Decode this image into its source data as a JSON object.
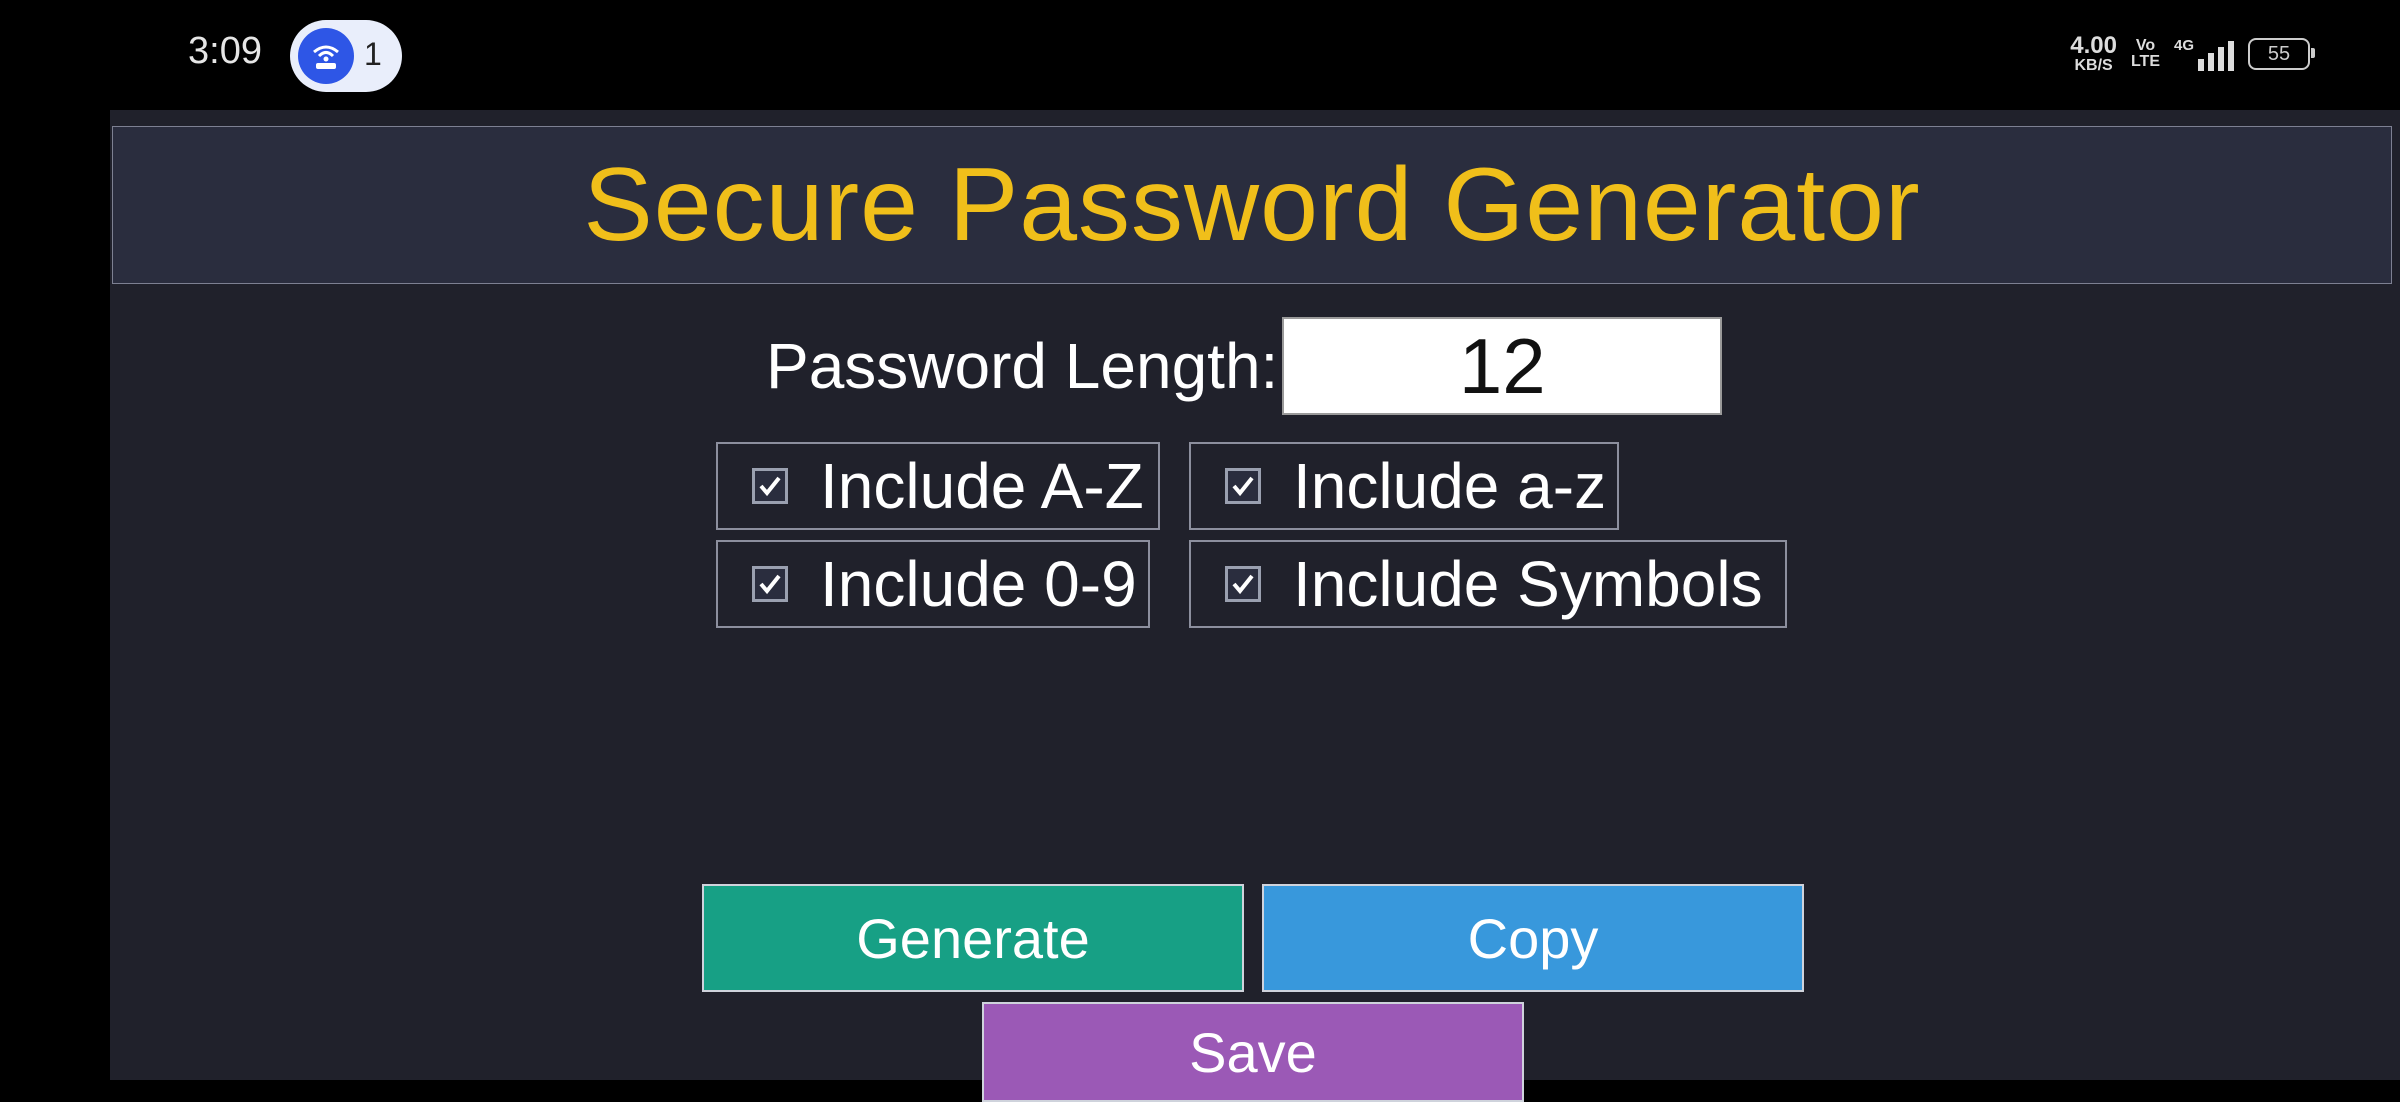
{
  "status_bar": {
    "time": "3:09",
    "hotspot_count": "1",
    "net_speed_value": "4.00",
    "net_speed_unit": "KB/S",
    "volte_top": "Vo",
    "volte_bottom": "LTE",
    "network_type": "4G",
    "battery_level": "55",
    "icons": [
      "wifi-hotspot-icon",
      "signal-icon",
      "battery-icon"
    ]
  },
  "app": {
    "title": "Secure Password Generator",
    "length_label": "Password Length:",
    "length_value": "12",
    "options": [
      {
        "label": "Include A-Z",
        "checked": true
      },
      {
        "label": "Include a-z",
        "checked": true
      },
      {
        "label": "Include 0-9",
        "checked": true
      },
      {
        "label": "Include Symbols",
        "checked": true
      }
    ],
    "buttons": {
      "generate": "Generate",
      "copy": "Copy",
      "save": "Save"
    },
    "colors": {
      "background": "#20212b",
      "header_bg": "#2a2d3e",
      "title": "#f0bf1a",
      "generate": "#17a085",
      "copy": "#3898dc",
      "save": "#9b59b6"
    }
  }
}
